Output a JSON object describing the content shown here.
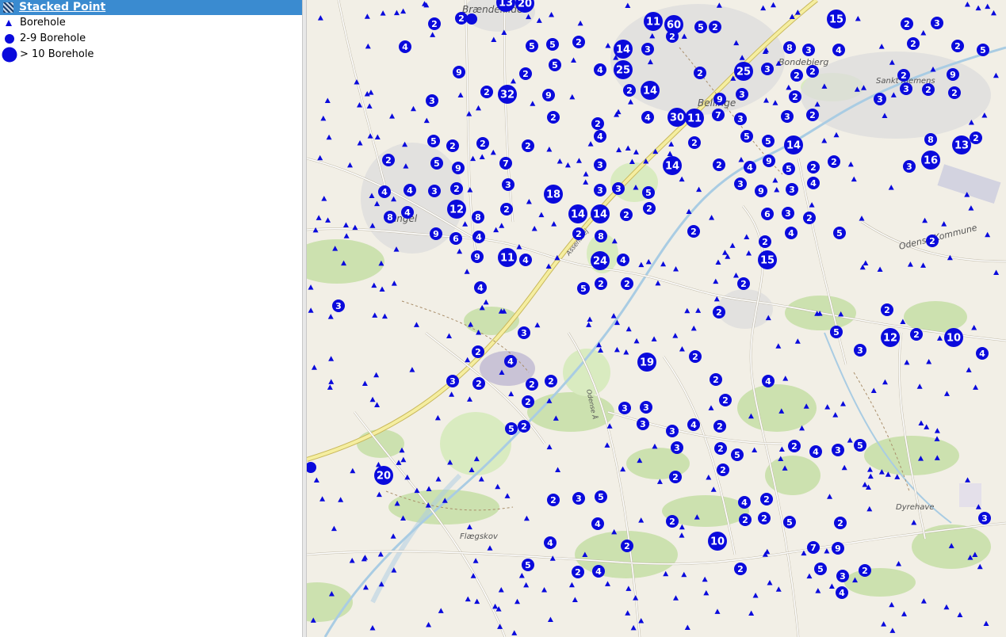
{
  "legend": {
    "title": "Stacked Point",
    "items": [
      {
        "label": "Borehole",
        "symbol": "triangle-icon"
      },
      {
        "label": "2-9 Borehole",
        "symbol": "small-circle-icon"
      },
      {
        "label": "> 10 Borehole",
        "symbol": "large-circle-icon"
      }
    ]
  },
  "colors": {
    "marker": "#0a0adc",
    "header": "#3a8bd0",
    "map_base": "#f2efe6",
    "forest": "#c8dfa8",
    "urban": "#dcdcdc",
    "water": "#a9cce3"
  },
  "map": {
    "place_labels": [
      "Bellinge",
      "Bondebjerg",
      "Sankt Klemens",
      "Odense Kommune",
      "Assensvej",
      "Flægskov",
      "Dyrehave",
      "Odense Å",
      "Brændekilde",
      "Fangel"
    ],
    "clusters": [
      "2",
      "4",
      "13",
      "20",
      "2",
      "60",
      "11",
      "5",
      "2",
      "15",
      "2",
      "3",
      "2",
      "8",
      "4",
      "5",
      "5",
      "2",
      "5",
      "14",
      "3",
      "4",
      "25",
      "2",
      "2",
      "25",
      "3",
      "2",
      "2",
      "3",
      "2",
      "5",
      "2",
      "3",
      "9",
      "3",
      "2",
      "9",
      "2",
      "3",
      "2",
      "32",
      "9",
      "2",
      "14",
      "9",
      "3",
      "2",
      "2",
      "2",
      "2",
      "4",
      "4",
      "30",
      "11",
      "7",
      "3",
      "3",
      "2",
      "5",
      "2",
      "2",
      "2",
      "2",
      "5",
      "5",
      "14",
      "8",
      "13",
      "2",
      "2",
      "5",
      "9",
      "7",
      "3",
      "14",
      "2",
      "4",
      "9",
      "5",
      "2",
      "2",
      "3",
      "16",
      "4",
      "4",
      "3",
      "2",
      "3",
      "18",
      "3",
      "3",
      "5",
      "3",
      "9",
      "3",
      "4",
      "8",
      "4",
      "12",
      "2",
      "8",
      "14",
      "14",
      "2",
      "2",
      "6",
      "3",
      "2",
      "9",
      "6",
      "4",
      "2",
      "8",
      "2",
      "4",
      "5",
      "2",
      "9",
      "11",
      "4",
      "24",
      "4",
      "2",
      "15",
      "4",
      "5",
      "2",
      "2",
      "2",
      "3",
      "2",
      "2",
      "5",
      "12",
      "2",
      "10",
      "4",
      "3",
      "2",
      "2",
      "3",
      "4",
      "19",
      "3",
      "2",
      "2",
      "2",
      "2",
      "4",
      "2",
      "2",
      "3",
      "3",
      "5",
      "2",
      "3",
      "3",
      "4",
      "2",
      "3",
      "2",
      "5",
      "2",
      "4",
      "3",
      "5",
      "2",
      "2",
      "20",
      "2",
      "3",
      "5",
      "4",
      "2",
      "4",
      "2",
      "2",
      "2",
      "5",
      "2",
      "3",
      "4",
      "2",
      "10",
      "7",
      "9",
      "5",
      "2",
      "4",
      "2",
      "5",
      "3",
      "2",
      "4"
    ]
  }
}
